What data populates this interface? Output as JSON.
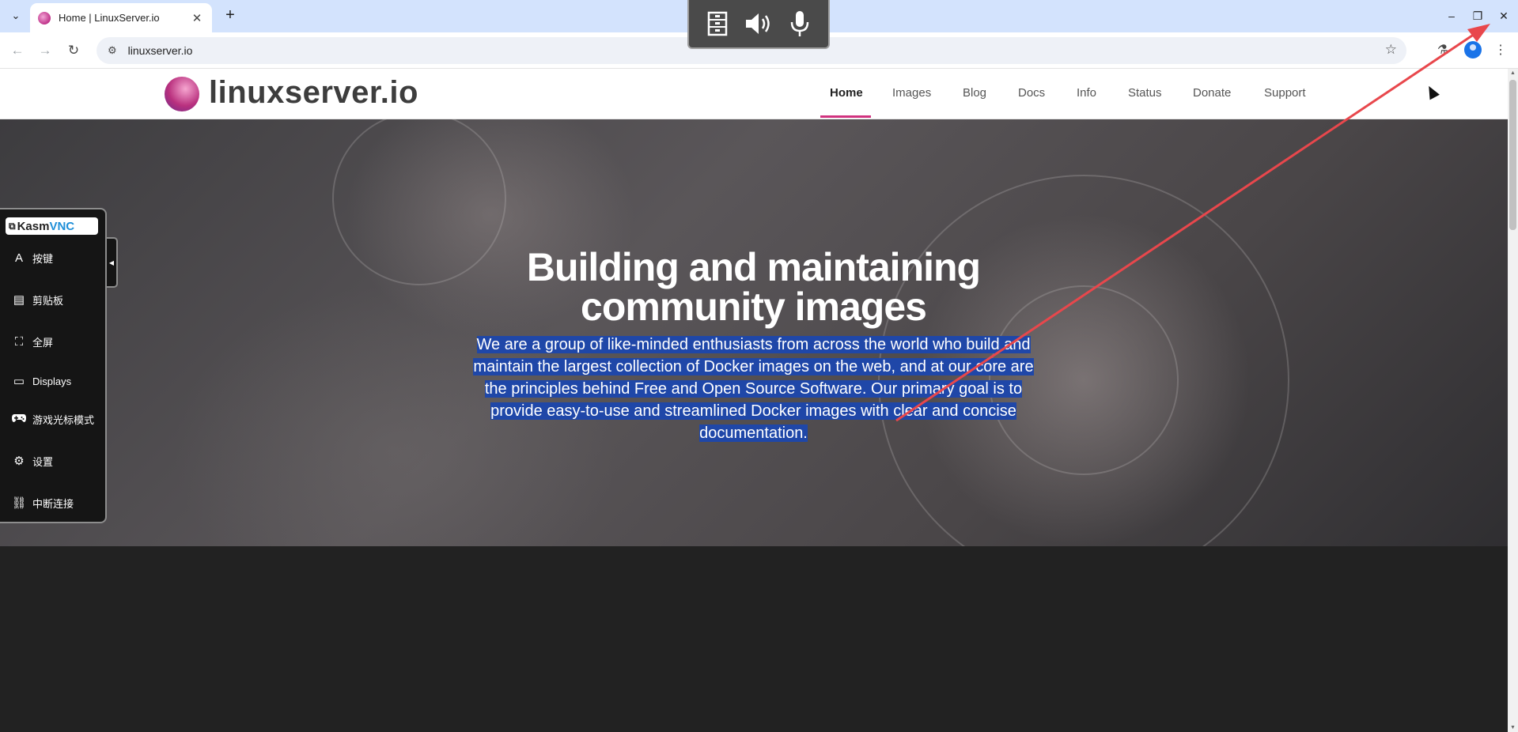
{
  "browser": {
    "tab_title": "Home | LinuxServer.io",
    "url": "linuxserver.io",
    "tab_close_glyph": "✕",
    "new_tab_glyph": "+",
    "back_glyph": "←",
    "forward_glyph": "→",
    "reload_glyph": "↻",
    "star_glyph": "☆",
    "menu_glyph": "⋮",
    "minimize_glyph": "–",
    "restore_glyph": "❐",
    "close_glyph": "✕",
    "tab_search_glyph": "⌄"
  },
  "site": {
    "logo_text": "linuxserver.io",
    "nav": [
      "Home",
      "Images",
      "Blog",
      "Docs",
      "Info",
      "Status",
      "Donate",
      "Support"
    ],
    "active_nav": "Home",
    "accent_color": "#d0337f"
  },
  "hero": {
    "title_line1": "Building and maintaining",
    "title_line2": "community images",
    "text": "We are a group of like-minded enthusiasts from across the world who build and maintain the largest collection of Docker images on the web, and at our core are the principles behind Free and Open Source Software. Our primary goal is to provide easy-to-use and streamlined Docker images with clear and concise documentation.",
    "highlight_color": "#1f47a8"
  },
  "kasm": {
    "logo_kasm": "Kasm",
    "logo_vnc": "VNC",
    "items": [
      {
        "label": "按键",
        "icon": "keyboard-icon"
      },
      {
        "label": "剪贴板",
        "icon": "clipboard-icon"
      },
      {
        "label": "全屏",
        "icon": "fullscreen-icon"
      },
      {
        "label": "Displays",
        "icon": "monitor-icon"
      },
      {
        "label": "游戏光标模式",
        "icon": "gamepad-icon"
      },
      {
        "label": "设置",
        "icon": "gear-icon"
      },
      {
        "label": "中断连接",
        "icon": "disconnect-icon"
      }
    ],
    "glyphs": [
      "A",
      "▤",
      "⛶",
      "▭",
      "🎮",
      "⚙",
      "⛓"
    ],
    "collapse_glyph": "◀"
  },
  "annotation": {
    "arrow_color": "#e8474c"
  }
}
